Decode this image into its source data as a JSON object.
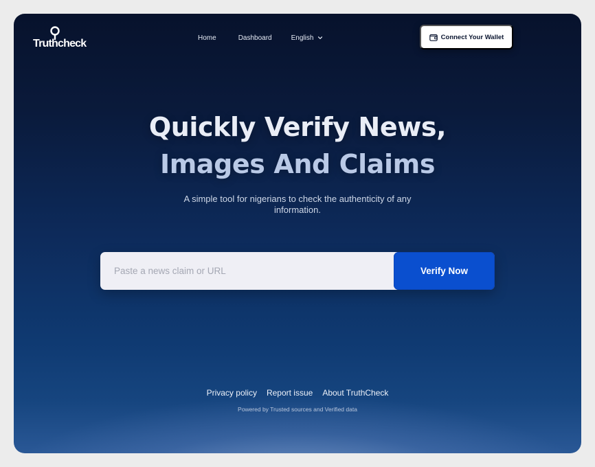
{
  "header": {
    "logo_text": "Truthcheck",
    "nav": [
      {
        "label": "Home"
      },
      {
        "label": "Dashboard"
      }
    ],
    "language": {
      "selected": "English"
    },
    "wallet_button": {
      "label": "Connect Your Wallet",
      "icon": "wallet-icon"
    }
  },
  "hero": {
    "title_line1": "Quickly Verify News,",
    "title_line2": "Images And Claims",
    "subtitle": "A simple tool for nigerians to check the authenticity of any information."
  },
  "search": {
    "placeholder": "Paste a news claim or URL",
    "value": "",
    "button_label": "Verify Now"
  },
  "footer": {
    "links": [
      {
        "label": "Privacy policy"
      },
      {
        "label": "Report issue"
      },
      {
        "label": "About TruthCheck"
      }
    ],
    "powered_by": "Powered by Trusted sources and Verified data"
  },
  "colors": {
    "background_top": "#07122c",
    "background_bottom": "#2a5896",
    "accent": "#0a4fcf",
    "search_field": "#efeff5"
  }
}
